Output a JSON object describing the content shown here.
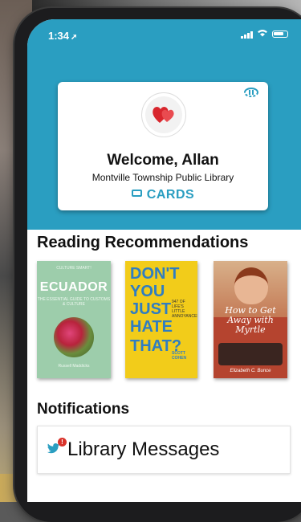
{
  "status_bar": {
    "time": "1:34",
    "location_arrow": "➚"
  },
  "profile_card": {
    "welcome": "Welcome, Allan",
    "library_name": "Montville Township Public Library",
    "cards_button": "CARDS",
    "sync_icon": "sync-icon",
    "avatar_icon": "hearts-icon"
  },
  "recommendations": {
    "title": "Reading Recommendations",
    "books": [
      {
        "cover_top": "CULTURE SMART!",
        "title": "ECUADOR",
        "subtitle": "THE ESSENTIAL GUIDE TO CUSTOMS & CULTURE",
        "footer": "Russell Maddicks",
        "color": "#9dcdab"
      },
      {
        "line1": "DON'T",
        "line2": "YOU",
        "line3": "JUST",
        "line4": "HATE",
        "line5": "THAT?",
        "side_text": "947 OF LIFE'S LITTLE ANNOYANCES",
        "author": "SCOTT COHEN",
        "color": "#f2cc1a"
      },
      {
        "title": "How to Get Away with Myrtle",
        "author": "Elizabeth C. Bunce",
        "color": "#b5442f"
      }
    ]
  },
  "notifications": {
    "title": "Notifications",
    "item_label": "Library Messages",
    "badge": "!"
  },
  "colors": {
    "accent": "#2a9ec1",
    "badge": "#d9332b"
  }
}
